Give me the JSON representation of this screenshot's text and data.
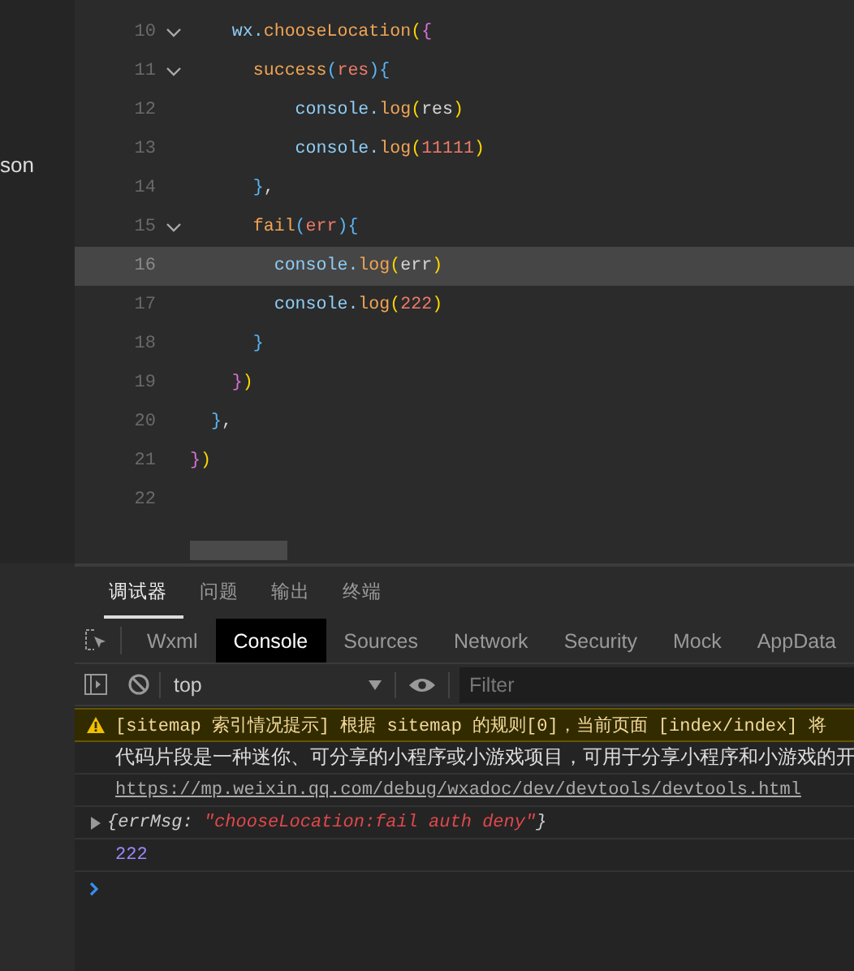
{
  "sidebar": {
    "item_label": "son"
  },
  "editor": {
    "lines": [
      {
        "number": "10",
        "foldable": true,
        "current": false,
        "tokens": [
          {
            "kind": "ident",
            "text": "    wx."
          },
          {
            "kind": "method",
            "text": "chooseLocation"
          },
          {
            "kind": "brace1",
            "text": "("
          },
          {
            "kind": "brace2",
            "text": "{"
          }
        ]
      },
      {
        "number": "11",
        "foldable": true,
        "current": false,
        "tokens": [
          {
            "kind": "method",
            "text": "      success"
          },
          {
            "kind": "brace3",
            "text": "("
          },
          {
            "kind": "param",
            "text": "res"
          },
          {
            "kind": "brace3",
            "text": ")"
          },
          {
            "kind": "brace3",
            "text": "{"
          }
        ]
      },
      {
        "number": "12",
        "foldable": false,
        "current": false,
        "tokens": [
          {
            "kind": "ident",
            "text": "          console."
          },
          {
            "kind": "method",
            "text": "log"
          },
          {
            "kind": "brace1",
            "text": "("
          },
          {
            "kind": "plain",
            "text": "res"
          },
          {
            "kind": "brace1",
            "text": ")"
          }
        ]
      },
      {
        "number": "13",
        "foldable": false,
        "current": false,
        "tokens": [
          {
            "kind": "ident",
            "text": "          console."
          },
          {
            "kind": "method",
            "text": "log"
          },
          {
            "kind": "brace1",
            "text": "("
          },
          {
            "kind": "number",
            "text": "11111"
          },
          {
            "kind": "brace1",
            "text": ")"
          }
        ]
      },
      {
        "number": "14",
        "foldable": false,
        "current": false,
        "tokens": [
          {
            "kind": "brace3",
            "text": "      }"
          },
          {
            "kind": "plain",
            "text": ","
          }
        ]
      },
      {
        "number": "15",
        "foldable": true,
        "current": false,
        "tokens": [
          {
            "kind": "method",
            "text": "      fail"
          },
          {
            "kind": "brace3",
            "text": "("
          },
          {
            "kind": "param",
            "text": "err"
          },
          {
            "kind": "brace3",
            "text": ")"
          },
          {
            "kind": "brace3",
            "text": "{"
          }
        ]
      },
      {
        "number": "16",
        "foldable": false,
        "current": true,
        "tokens": [
          {
            "kind": "ident",
            "text": "        console."
          },
          {
            "kind": "method",
            "text": "log"
          },
          {
            "kind": "brace1",
            "text": "("
          },
          {
            "kind": "plain",
            "text": "err"
          },
          {
            "kind": "brace1",
            "text": ")"
          }
        ]
      },
      {
        "number": "17",
        "foldable": false,
        "current": false,
        "tokens": [
          {
            "kind": "ident",
            "text": "        console."
          },
          {
            "kind": "method",
            "text": "log"
          },
          {
            "kind": "brace1",
            "text": "("
          },
          {
            "kind": "number",
            "text": "222"
          },
          {
            "kind": "brace1",
            "text": ")"
          }
        ]
      },
      {
        "number": "18",
        "foldable": false,
        "current": false,
        "tokens": [
          {
            "kind": "brace3",
            "text": "      }"
          }
        ]
      },
      {
        "number": "19",
        "foldable": false,
        "current": false,
        "tokens": [
          {
            "kind": "brace2",
            "text": "    }"
          },
          {
            "kind": "brace1",
            "text": ")"
          }
        ]
      },
      {
        "number": "20",
        "foldable": false,
        "current": false,
        "tokens": [
          {
            "kind": "brace3",
            "text": "  }"
          },
          {
            "kind": "plain",
            "text": ","
          }
        ]
      },
      {
        "number": "21",
        "foldable": false,
        "current": false,
        "tokens": [
          {
            "kind": "brace2",
            "text": "}"
          },
          {
            "kind": "brace1",
            "text": ")"
          }
        ]
      },
      {
        "number": "22",
        "foldable": false,
        "current": false
      }
    ]
  },
  "panel_tabs": [
    {
      "label": "调试器",
      "selected": true
    },
    {
      "label": "问题",
      "selected": false
    },
    {
      "label": "输出",
      "selected": false
    },
    {
      "label": "终端",
      "selected": false
    }
  ],
  "devtools_tabs": [
    {
      "label": "Wxml",
      "selected": false
    },
    {
      "label": "Console",
      "selected": true
    },
    {
      "label": "Sources",
      "selected": false
    },
    {
      "label": "Network",
      "selected": false
    },
    {
      "label": "Security",
      "selected": false
    },
    {
      "label": "Mock",
      "selected": false
    },
    {
      "label": "AppData",
      "selected": false
    }
  ],
  "console_toolbar": {
    "context": "top",
    "filter": {
      "placeholder": "Filter"
    }
  },
  "console_messages": [
    {
      "kind": "warning",
      "text": "[sitemap 索引情况提示] 根据 sitemap 的规则[0]，当前页面 [index/index] 将"
    },
    {
      "kind": "info",
      "text": "代码片段是一种迷你、可分享的小程序或小游戏项目，可用于分享小程序和小游戏的开"
    },
    {
      "kind": "link",
      "text": "https://mp.weixin.qq.com/debug/wxadoc/dev/devtools/devtools.html"
    },
    {
      "kind": "object",
      "open": "{",
      "key": "errMsg",
      "colon": ":",
      "value": "\"chooseLocation:fail auth deny\"",
      "close": "}"
    },
    {
      "kind": "number",
      "text": "222"
    }
  ]
}
